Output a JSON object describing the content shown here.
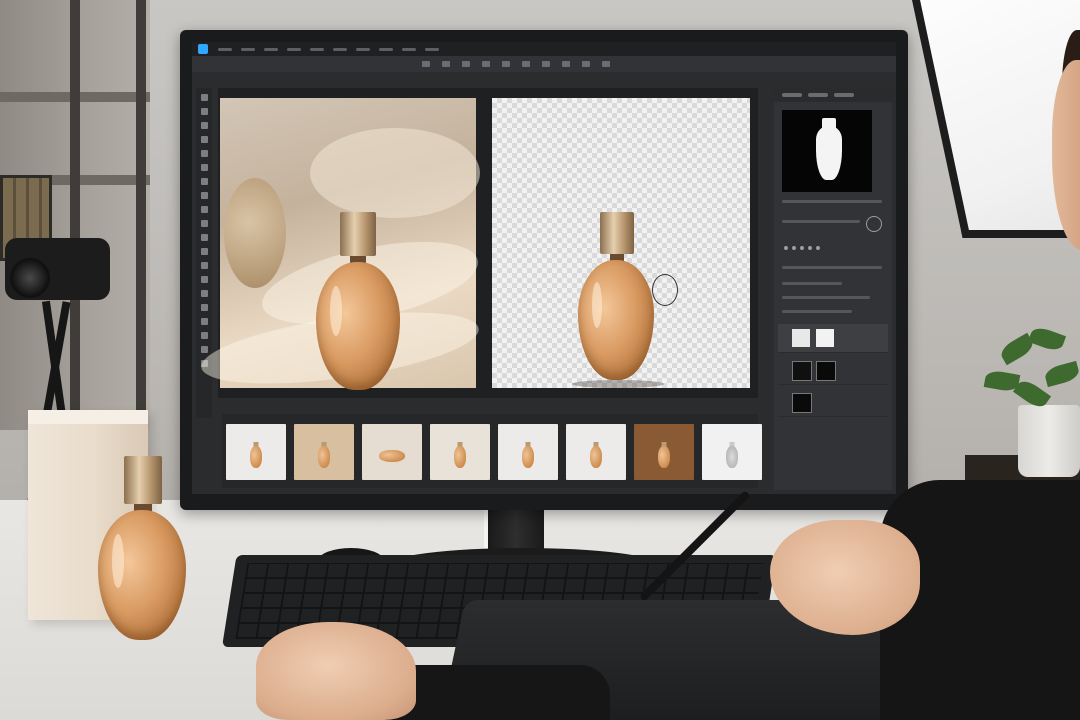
{
  "scene": {
    "description_type": "photo",
    "colors": {
      "monitor_bezel": "#1a1b1d",
      "app_ui": "#2b2c2e",
      "accent_app_logo": "#31a8ff",
      "bottle_amber": "#d99b62",
      "bottle_cap_gold": "#e5cfae",
      "desk": "#e9e7e4"
    }
  },
  "editor": {
    "left_image": "original-product-photo",
    "right_image": "background-removed-cutout",
    "mask_preview": "bottle-mask",
    "filmstrip_count": 8
  },
  "icons": {
    "app_logo": "app-logo-icon",
    "brush_cursor": "brush-cursor-icon"
  }
}
